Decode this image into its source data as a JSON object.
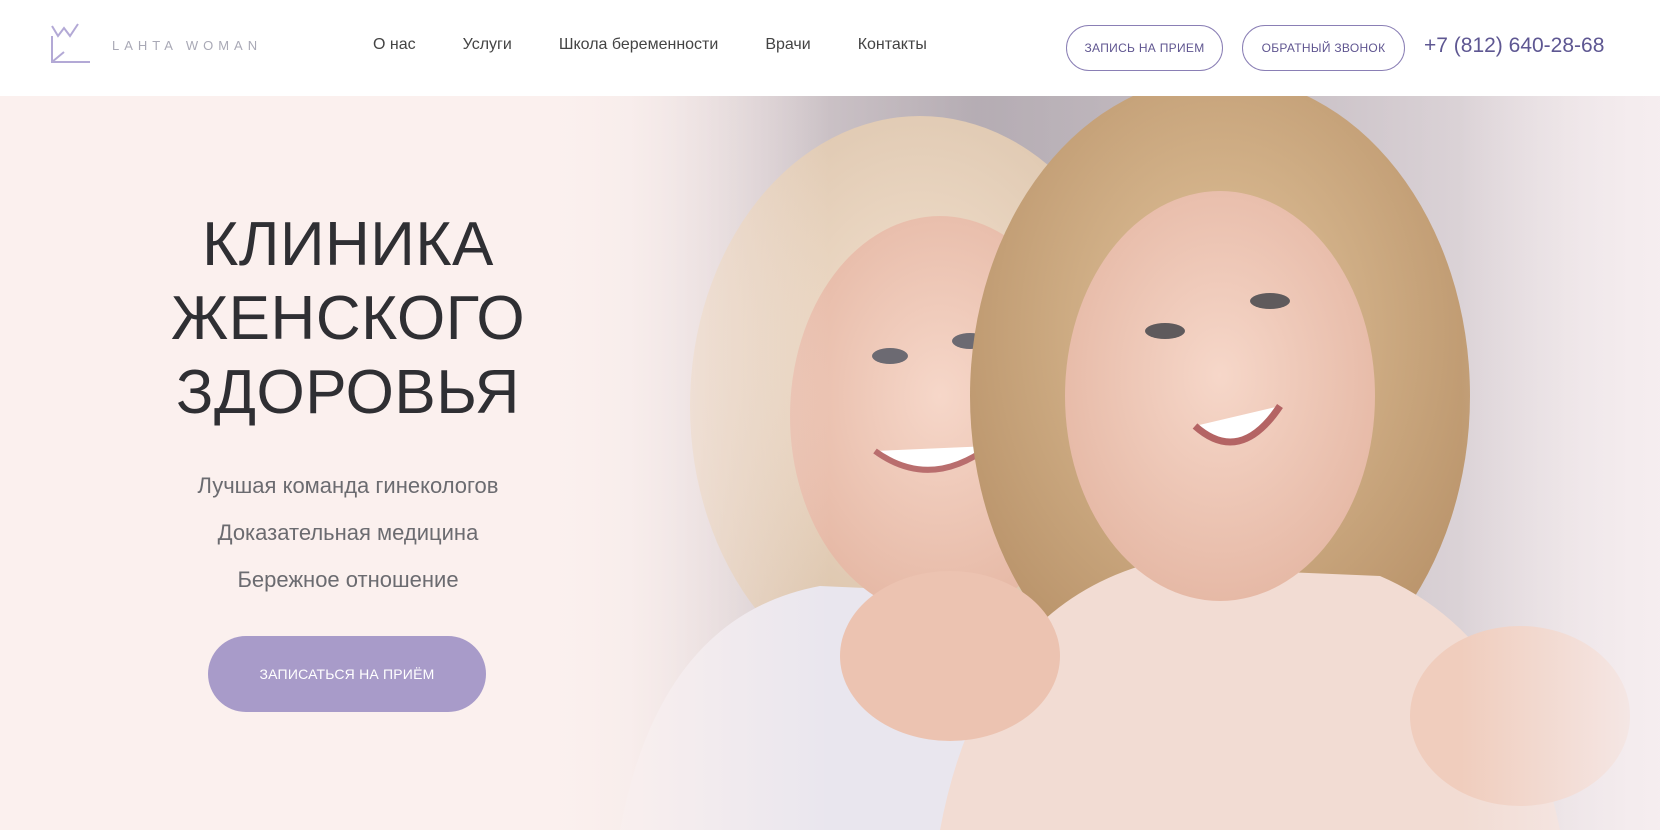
{
  "brand": {
    "logo_text": "LAHTA WOMAN",
    "accent_color": "#a89bc9",
    "outline_color": "#8a7fb5"
  },
  "nav": {
    "items": [
      {
        "label": "О нас"
      },
      {
        "label": "Услуги"
      },
      {
        "label": "Школа беременности"
      },
      {
        "label": "Врачи"
      },
      {
        "label": "Контакты"
      }
    ]
  },
  "header": {
    "appointment_button": "ЗАПИСЬ НА ПРИЕМ",
    "callback_button": "ОБРАТНЫЙ ЗВОНОК",
    "phone": "+7 (812) 640-28-68"
  },
  "hero": {
    "title_lines": [
      "КЛИНИКА",
      "ЖЕНСКОГО",
      "ЗДОРОВЬЯ"
    ],
    "features": [
      "Лучшая команда гинекологов",
      "Доказательная медицина",
      "Бережное отношение"
    ],
    "cta_button": "ЗАПИСАТЬСЯ НА ПРИЁМ",
    "image_icon": "photo-two-women-smiling"
  }
}
